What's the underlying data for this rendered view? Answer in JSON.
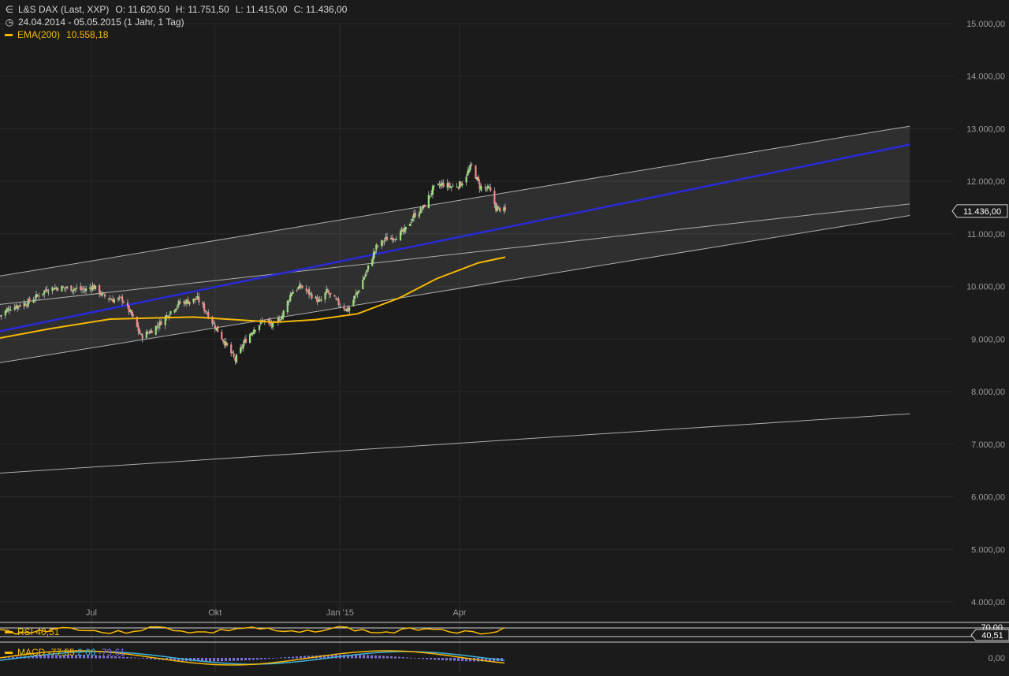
{
  "header": {
    "instrument": "L&S DAX (Last, XXP)",
    "open": "O: 11.620,50",
    "high": "H: 11.751,50",
    "low": "L: 11.415,00",
    "close": "C: 11.436,00",
    "range": "24.04.2014 - 05.05.2015 (1 Jahr, 1 Tag)",
    "ema_label": "EMA(200)",
    "ema_value": "10.558,18"
  },
  "price_badge": "11.436,00",
  "rsi": {
    "label": "RSI",
    "value": "40,51",
    "level_label": "70,00",
    "badge": "40,51"
  },
  "macd": {
    "label": "MACD",
    "v1": "-77,55",
    "v2": "2,06",
    "v3": "-79,61",
    "zero_label": "0,00"
  },
  "colors": {
    "background": "#1b1b1b",
    "up": "#9be07a",
    "down": "#f08a8a",
    "ema": "#f5b800",
    "trend": "#2a2ad8",
    "channel": "#d0d0d0",
    "macd_line": "#f5b800",
    "signal_line": "#3fb0d8",
    "histogram": "#7a6fd8"
  },
  "icons": {
    "instrument": "candlestick-icon",
    "period": "clock-icon"
  },
  "chart_data": {
    "type": "line",
    "series_name": "L&S DAX (Last, XXP)",
    "yticks": [
      "15.000,00",
      "14.000,00",
      "13.000,00",
      "12.000,00",
      "11.000,00",
      "10.000,00",
      "9.000,00",
      "8.000,00",
      "7.000,00",
      "6.000,00",
      "5.000,00",
      "4.000,00"
    ],
    "ylim": [
      4000,
      15000
    ],
    "xticks": [
      "Jul",
      "Okt",
      "Jan '15",
      "Apr"
    ],
    "x_range": [
      "2014-04-24",
      "2015-05-05"
    ],
    "prices": [
      [
        "2014-04-24",
        9440
      ],
      [
        "2014-05-01",
        9590
      ],
      [
        "2014-05-15",
        9700
      ],
      [
        "2014-05-29",
        9950
      ],
      [
        "2014-06-05",
        9980
      ],
      [
        "2014-06-19",
        9960
      ],
      [
        "2014-06-26",
        9930
      ],
      [
        "2014-07-02",
        10010
      ],
      [
        "2014-07-10",
        9820
      ],
      [
        "2014-07-17",
        9750
      ],
      [
        "2014-07-24",
        9760
      ],
      [
        "2014-07-31",
        9450
      ],
      [
        "2014-08-07",
        9050
      ],
      [
        "2014-08-14",
        9150
      ],
      [
        "2014-08-21",
        9300
      ],
      [
        "2014-08-28",
        9500
      ],
      [
        "2014-09-04",
        9680
      ],
      [
        "2014-09-11",
        9720
      ],
      [
        "2014-09-18",
        9760
      ],
      [
        "2014-09-25",
        9500
      ],
      [
        "2014-10-02",
        9200
      ],
      [
        "2014-10-09",
        8900
      ],
      [
        "2014-10-16",
        8600
      ],
      [
        "2014-10-23",
        8950
      ],
      [
        "2014-10-30",
        9200
      ],
      [
        "2014-11-06",
        9350
      ],
      [
        "2014-11-13",
        9250
      ],
      [
        "2014-11-20",
        9450
      ],
      [
        "2014-11-27",
        9900
      ],
      [
        "2014-12-04",
        10000
      ],
      [
        "2014-12-11",
        9850
      ],
      [
        "2014-12-18",
        9700
      ],
      [
        "2014-12-23",
        9900
      ],
      [
        "2015-01-02",
        9650
      ],
      [
        "2015-01-08",
        9550
      ],
      [
        "2015-01-15",
        9900
      ],
      [
        "2015-01-22",
        10300
      ],
      [
        "2015-01-29",
        10750
      ],
      [
        "2015-02-05",
        10900
      ],
      [
        "2015-02-12",
        10950
      ],
      [
        "2015-02-19",
        11050
      ],
      [
        "2015-02-26",
        11350
      ],
      [
        "2015-03-05",
        11500
      ],
      [
        "2015-03-12",
        11850
      ],
      [
        "2015-03-19",
        11950
      ],
      [
        "2015-03-26",
        11900
      ],
      [
        "2015-04-02",
        11950
      ],
      [
        "2015-04-10",
        12300
      ],
      [
        "2015-04-16",
        11900
      ],
      [
        "2015-04-23",
        11850
      ],
      [
        "2015-04-28",
        11500
      ],
      [
        "2015-05-05",
        11436
      ]
    ],
    "ema200": [
      [
        "2014-04-24",
        9020
      ],
      [
        "2014-06-01",
        9200
      ],
      [
        "2014-07-15",
        9380
      ],
      [
        "2014-08-15",
        9400
      ],
      [
        "2014-09-15",
        9420
      ],
      [
        "2014-10-15",
        9370
      ],
      [
        "2014-11-15",
        9320
      ],
      [
        "2014-12-15",
        9370
      ],
      [
        "2015-01-15",
        9480
      ],
      [
        "2015-02-15",
        9780
      ],
      [
        "2015-03-15",
        10150
      ],
      [
        "2015-04-15",
        10450
      ],
      [
        "2015-05-05",
        10558
      ]
    ],
    "trend_line": [
      [
        "2014-04-24",
        9150
      ],
      [
        "2016-03-01",
        12700
      ]
    ],
    "channel_upper": [
      [
        "2014-04-24",
        10200
      ],
      [
        "2016-03-01",
        13050
      ]
    ],
    "channel_lower": [
      [
        "2014-04-24",
        8550
      ],
      [
        "2016-03-01",
        11350
      ]
    ],
    "mid_line": [
      [
        "2014-04-24",
        9660
      ],
      [
        "2016-03-01",
        11570
      ]
    ],
    "support_line": [
      [
        "2014-04-24",
        6450
      ],
      [
        "2016-03-01",
        7580
      ]
    ]
  }
}
